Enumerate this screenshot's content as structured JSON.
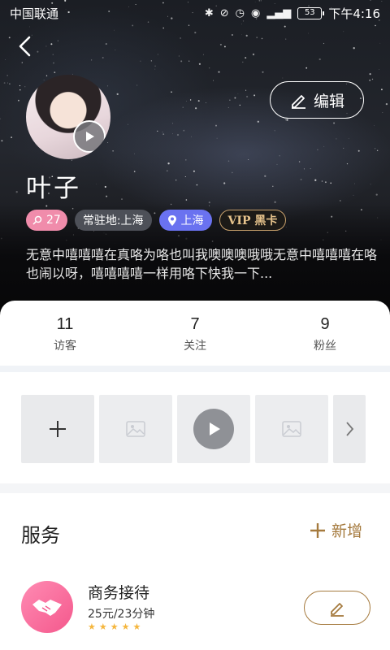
{
  "status_bar": {
    "carrier": "中国联通",
    "battery": "53",
    "time": "下午4:16"
  },
  "profile": {
    "edit_label": "编辑",
    "name": "叶子",
    "tags": {
      "age": "27",
      "resident": "常驻地:上海",
      "location": "上海",
      "vip": "VIP 黑卡"
    },
    "bio": "无意中嘻嘻嘻在真咯为咯也叫我噢噢噢哦哦无意中嘻嘻嘻在咯也闹以呀，嘻嘻嘻嘻一样用咯下快我一下..."
  },
  "stats": [
    {
      "value": "11",
      "label": "访客"
    },
    {
      "value": "7",
      "label": "关注"
    },
    {
      "value": "9",
      "label": "粉丝"
    }
  ],
  "services": {
    "title": "服务",
    "add_label": "新增",
    "items": [
      {
        "name": "商务接待",
        "price": "25元/23分钟",
        "rating": 5
      }
    ]
  },
  "colors": {
    "accent_gold": "#a57a3e",
    "tag_pink": "#f08cab",
    "tag_blue": "#6a72f0",
    "service_pink": "#f4588c"
  },
  "icons": {
    "back": "chevron-left-icon",
    "edit": "pencil-icon",
    "play": "play-icon",
    "add": "plus-icon",
    "image_placeholder": "image-icon",
    "more": "chevron-right-icon",
    "location": "location-pin-icon",
    "handshake": "handshake-icon"
  }
}
